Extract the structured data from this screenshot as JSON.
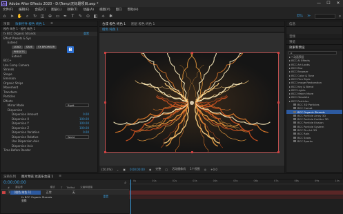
{
  "titlebar": {
    "app_icon": "Ae",
    "title": "Adobe After Effects 2020 - D:\\Temp\\无标题项目.aep *",
    "minimize": "—",
    "maximize": "☐",
    "close": "✕"
  },
  "menu": [
    "文件(F)",
    "编辑(E)",
    "合成(C)",
    "图层(L)",
    "效果(T)",
    "动画(A)",
    "视图(V)",
    "窗口",
    "帮助(H)"
  ],
  "toolbar": {
    "tools": [
      "home-icon",
      "selection-icon",
      "hand-icon",
      "zoom-icon",
      "rotate-icon",
      "camera-icon",
      "pan-behind-icon",
      "rect-icon",
      "pen-icon",
      "text-icon",
      "brush-icon",
      "clone-icon",
      "eraser-icon",
      "roto-icon",
      "puppet-icon"
    ],
    "workspace": "默认",
    "workspace_dd": "≫",
    "search_placeholder": ""
  },
  "effect_controls": {
    "tabs": [
      "项目",
      "效果控件 橙色 纯色 1",
      "≡"
    ],
    "comp_line": "橙色 纯色 1 · 橙色 纯色 1",
    "lines": [
      {
        "label": "fx  BCC Organic Strands",
        "value": "重置",
        "level": 0,
        "hdr": true
      },
      {
        "label": "Effect Presets & Sys",
        "value": "",
        "level": 1
      },
      {
        "label": "Extend",
        "value": "",
        "level": 2
      },
      {
        "label": "BCC+",
        "value": "",
        "level": 1
      },
      {
        "label": "Use Comp Camera",
        "value": "",
        "level": 1
      },
      {
        "label": "Strands",
        "value": "",
        "level": 1
      },
      {
        "label": "Shape",
        "value": "",
        "level": 1
      },
      {
        "label": "Emission",
        "value": "",
        "level": 1
      },
      {
        "label": "Organic Strips",
        "value": "",
        "level": 1
      },
      {
        "label": "Movement",
        "value": "",
        "level": 1
      },
      {
        "label": "Transform",
        "value": "",
        "level": 1
      },
      {
        "label": "Particles",
        "value": "",
        "level": 1
      },
      {
        "label": "Effects",
        "value": "",
        "level": 1
      },
      {
        "label": "Mirror Mode",
        "value": "Right",
        "level": 2,
        "dd": true
      },
      {
        "label": "Dispersion",
        "value": "",
        "level": 2
      },
      {
        "label": "Dispersion Amount",
        "value": "0.00",
        "level": 3
      },
      {
        "label": "Dispersion X",
        "value": "100.00",
        "level": 3
      },
      {
        "label": "Dispersion Y",
        "value": "100.00",
        "level": 3
      },
      {
        "label": "Dispersion Z",
        "value": "100.00",
        "level": 3
      },
      {
        "label": "Dispersion Variation",
        "value": "0.00",
        "level": 3
      },
      {
        "label": "Dispersion Relative",
        "value": "World",
        "level": 3,
        "dd": true
      },
      {
        "label": "Use Dispersion Axis",
        "value": "",
        "level": 3
      },
      {
        "label": "Dispersion Axis",
        "value": "",
        "level": 3
      },
      {
        "label": "Time Before Render",
        "value": "",
        "level": 1
      }
    ],
    "preset_buttons": [
      "LOAD",
      "SAVE",
      "FX BROWSER",
      "PRESETS"
    ],
    "preset_name": "Extend",
    "brand_logo": "B"
  },
  "composition": {
    "tabs": [
      "合成 橙色 纯色 1",
      "图层 橙色 纯色 1"
    ],
    "viewer_tab": "橙色 纯色 1",
    "footer": [
      "(50.0%)",
      "⌄",
      "▣",
      "0:00:00:00",
      "◉",
      "完整",
      "▢",
      "活动摄像机",
      "1个视图",
      "◎",
      "+0.0"
    ]
  },
  "right_panel": {
    "tabs": [
      "信息",
      "音频",
      "预览",
      "效果和预设"
    ],
    "search_placeholder": "ρ",
    "lines": [
      {
        "label": "* 动画预设",
        "level": 0
      },
      {
        "label": "BCC AI Effects",
        "level": 0
      },
      {
        "label": "BCC Art Looks",
        "level": 0
      },
      {
        "label": "BCC Blur",
        "level": 0
      },
      {
        "label": "BCC Browser",
        "level": 0
      },
      {
        "label": "BCC Color & Tone",
        "level": 0
      },
      {
        "label": "BCC Film Style",
        "level": 0
      },
      {
        "label": "BCC Image Restoration",
        "level": 0
      },
      {
        "label": "BCC Key & Blend",
        "level": 0
      },
      {
        "label": "BCC Lights",
        "level": 0
      },
      {
        "label": "BCC Match Move",
        "level": 0
      },
      {
        "label": "BCC Obsolete",
        "level": 0
      },
      {
        "label": "BCC Particles",
        "level": 0
      },
      {
        "label": "BCC 3D Particles",
        "level": 1
      },
      {
        "label": "BCC Comet",
        "level": 1
      },
      {
        "label": "BCC Organic Strands",
        "level": 1,
        "sel": true
      },
      {
        "label": "BCC Particle Array 3D",
        "level": 1
      },
      {
        "label": "BCC Particle Emitter 3D",
        "level": 1
      },
      {
        "label": "BCC Particle Illusion",
        "level": 1
      },
      {
        "label": "BCC Particle System",
        "level": 1
      },
      {
        "label": "BCC Pin Art 3D",
        "level": 1
      },
      {
        "label": "BCC Rain",
        "level": 1
      },
      {
        "label": "BCC Snow",
        "level": 1
      },
      {
        "label": "BCC Sparks",
        "level": 1
      }
    ]
  },
  "timeline": {
    "tabs": [
      "渲染队列",
      "图片预览 达美乐合成 1",
      "≡"
    ],
    "timecode": "0:00:00:00",
    "columns": [
      "#",
      "源名称",
      "模式",
      "T",
      "TrkMat",
      "父级和链接"
    ],
    "layer_name": "[橙色 纯色 1]",
    "layer_num": "1",
    "layer_mode": "正常",
    "layer_parent": "无",
    "sublayer": "fx BCC Organic Strands",
    "sublayer2": "变换",
    "ruler": [
      "0s",
      "01s",
      "02s",
      "03s",
      "04s",
      "05s",
      "06s",
      "07s",
      "08s",
      "09s",
      "10s"
    ],
    "sub_button": "重置"
  },
  "colors": {
    "accent_blue": "#3a9ad9",
    "layer_red": "#5a2626",
    "selection": "#2d5aa0",
    "strand_orange": "#e8802c"
  }
}
